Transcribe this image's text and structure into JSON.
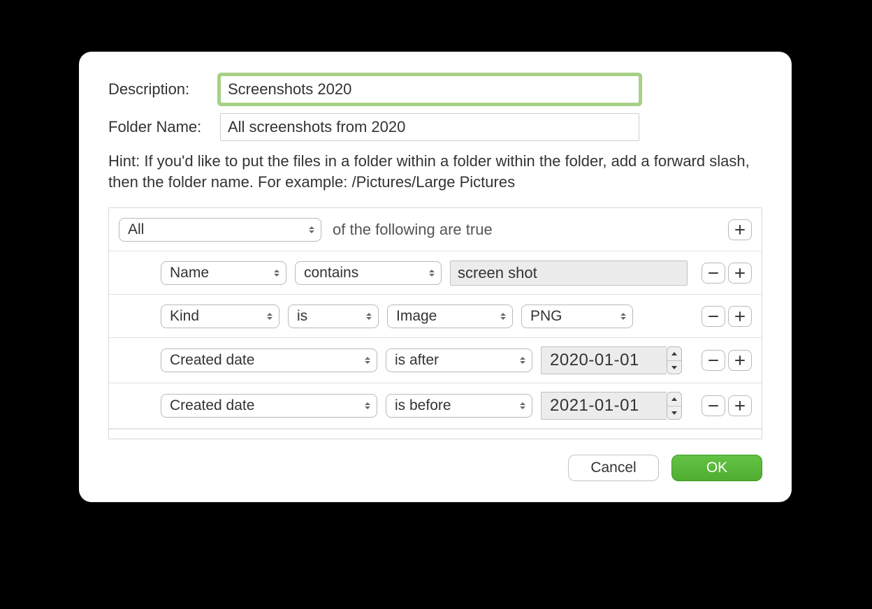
{
  "form": {
    "description_label": "Description:",
    "description_value": "Screenshots 2020",
    "folder_label": "Folder Name:",
    "folder_value": "All screenshots from 2020"
  },
  "hint": "Hint: If you'd like to put the files in a folder within a folder within the folder, add a forward slash, then the folder name.  For example: /Pictures/Large Pictures",
  "rules": {
    "match": "All",
    "match_suffix": "of the following are true",
    "rows": [
      {
        "attr": "Name",
        "op": "contains",
        "value": "screen shot"
      },
      {
        "attr": "Kind",
        "op": "is",
        "kind": "Image",
        "subkind": "PNG"
      },
      {
        "attr": "Created date",
        "op": "is after",
        "date": "2020-01-01"
      },
      {
        "attr": "Created date",
        "op": "is before",
        "date": "2021-01-01"
      }
    ]
  },
  "buttons": {
    "cancel": "Cancel",
    "ok": "OK"
  }
}
